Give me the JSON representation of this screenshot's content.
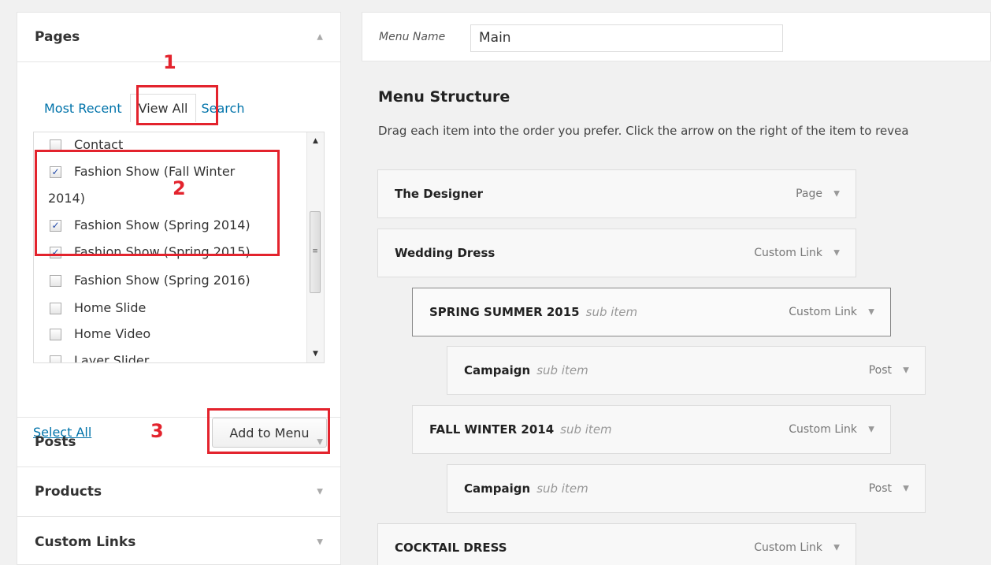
{
  "sidebar": {
    "pages_title": "Pages",
    "tabs": {
      "most_recent": "Most Recent",
      "view_all": "View All",
      "search": "Search"
    },
    "checklist": [
      {
        "label": "Contact",
        "checked": false
      },
      {
        "label": "Fashion Show (Fall Winter",
        "label2": "2014)",
        "checked": true
      },
      {
        "label": "Fashion Show (Spring 2014)",
        "checked": true
      },
      {
        "label": "Fashion Show (Spring 2015)",
        "checked": true
      },
      {
        "label": "Fashion Show (Spring 2016)",
        "checked": false
      },
      {
        "label": "Home Slide",
        "checked": false
      },
      {
        "label": "Home Video",
        "checked": false
      },
      {
        "label": "Layer Slider",
        "checked": false
      }
    ],
    "select_all": "Select All",
    "add_to_menu": "Add to Menu",
    "sections": [
      "Posts",
      "Products",
      "Custom Links"
    ],
    "annotations": [
      "1",
      "2",
      "3"
    ]
  },
  "menu": {
    "name_label": "Menu Name",
    "name_value": "Main",
    "structure_title": "Menu Structure",
    "structure_desc": "Drag each item into the order you prefer. Click the arrow on the right of the item to revea",
    "sub_label": "sub item",
    "items": [
      {
        "title": "The Designer",
        "sub": "",
        "type": "Page"
      },
      {
        "title": "Wedding Dress",
        "sub": "",
        "type": "Custom Link"
      },
      {
        "title": "SPRING SUMMER 2015",
        "sub": "sub item",
        "type": "Custom Link"
      },
      {
        "title": "Campaign",
        "sub": "sub item",
        "type": "Post"
      },
      {
        "title": "FALL WINTER 2014",
        "sub": "sub item",
        "type": "Custom Link"
      },
      {
        "title": "Campaign",
        "sub": "sub item",
        "type": "Post"
      },
      {
        "title": "COCKTAIL DRESS",
        "sub": "",
        "type": "Custom Link"
      }
    ]
  },
  "colors": {
    "link": "#0073aa",
    "annotation": "#e3232d"
  },
  "icons": {
    "collapse": "triangle-up-icon",
    "expand": "triangle-down-icon"
  }
}
